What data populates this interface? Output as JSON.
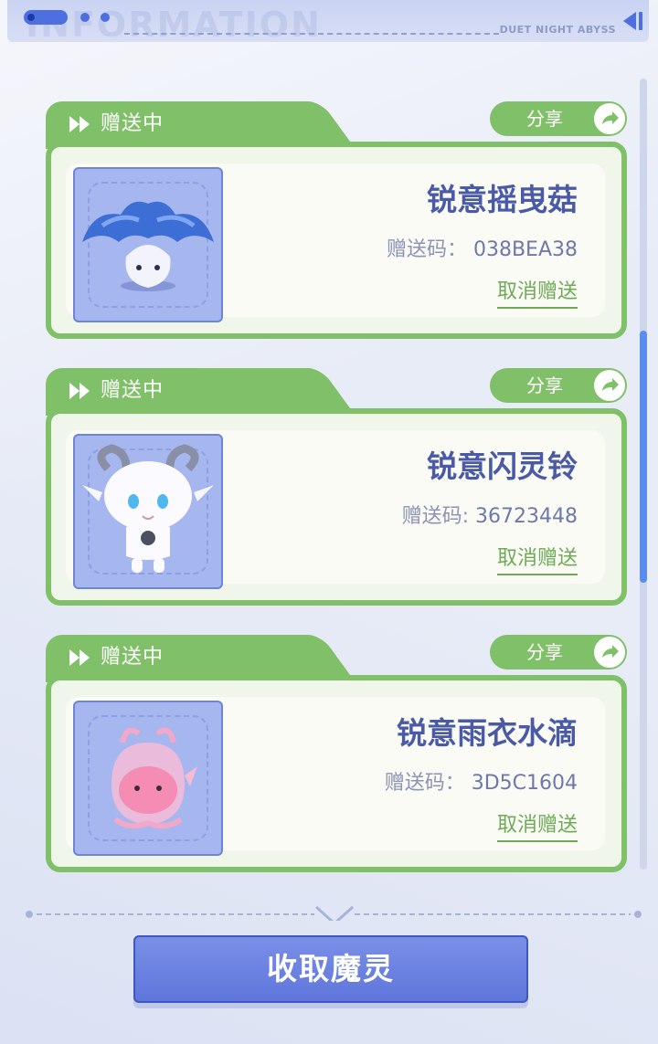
{
  "header": {
    "watermark": "INFORMATION",
    "brand": "DUET NIGHT ABYSS"
  },
  "colors": {
    "accent_green": "#80c068",
    "accent_blue": "#5f76dc",
    "name_text": "#4a5aa6"
  },
  "cards": [
    {
      "status": "赠送中",
      "share_label": "分享",
      "name": "锐意摇曳菇",
      "code_label": "赠送码：",
      "code": "038BEA38",
      "cancel_label": "取消赠送",
      "thumb_icon": "blue-mushroom-creature-icon"
    },
    {
      "status": "赠送中",
      "share_label": "分享",
      "name": "锐意闪灵铃",
      "code_label": "赠送码:",
      "code": "36723448",
      "cancel_label": "取消赠送",
      "thumb_icon": "white-goat-creature-icon"
    },
    {
      "status": "赠送中",
      "share_label": "分享",
      "name": "锐意雨衣水滴",
      "code_label": "赠送码：",
      "code": "3D5C1604",
      "cancel_label": "取消赠送",
      "thumb_icon": "pink-water-drop-creature-icon"
    }
  ],
  "footer": {
    "collect_label": "收取魔灵"
  }
}
